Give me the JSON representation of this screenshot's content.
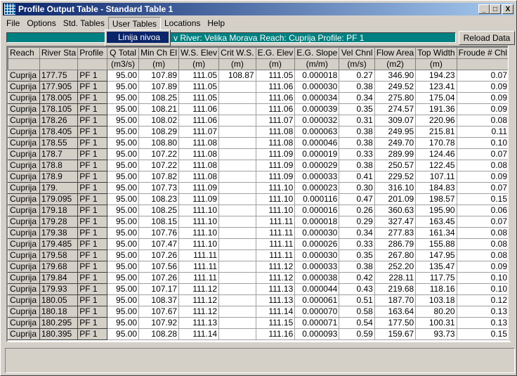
{
  "window": {
    "title": "Profile Output Table - Standard Table 1",
    "controls": [
      "_",
      "□",
      "X"
    ]
  },
  "menu": [
    "File",
    "Options",
    "Std. Tables",
    "User Tables",
    "Locations",
    "Help"
  ],
  "dropdown": {
    "items": [
      "Linija nivoa"
    ]
  },
  "banner": "v  River: Velika Morava   Reach: Cuprija    Profile: PF 1",
  "reload_label": "Reload Data",
  "colors": {
    "banner": "#008080",
    "title_start": "#0a246a",
    "selection": "#0a246a"
  },
  "table": {
    "headers": [
      "Reach",
      "River Sta",
      "Profile",
      "Q Total",
      "Min Ch El",
      "W.S. Elev",
      "Crit W.S.",
      "E.G. Elev",
      "E.G. Slope",
      "Vel Chnl",
      "Flow Area",
      "Top Width",
      "Froude # Chl"
    ],
    "units": [
      "",
      "",
      "",
      "(m3/s)",
      "(m)",
      "(m)",
      "(m)",
      "(m)",
      "(m/m)",
      "(m/s)",
      "(m2)",
      "(m)",
      ""
    ],
    "rows": [
      [
        "Cuprija",
        "177.75",
        "PF 1",
        "95.00",
        "107.89",
        "111.05",
        "108.87",
        "111.05",
        "0.000018",
        "0.27",
        "346.90",
        "194.23",
        "0.07"
      ],
      [
        "Cuprija",
        "177.905",
        "PF 1",
        "95.00",
        "107.89",
        "111.05",
        "",
        "111.06",
        "0.000030",
        "0.38",
        "249.52",
        "123.41",
        "0.09"
      ],
      [
        "Cuprija",
        "178.005",
        "PF 1",
        "95.00",
        "108.25",
        "111.05",
        "",
        "111.06",
        "0.000034",
        "0.34",
        "275.80",
        "175.04",
        "0.09"
      ],
      [
        "Cuprija",
        "178.105",
        "PF 1",
        "95.00",
        "108.21",
        "111.06",
        "",
        "111.06",
        "0.000039",
        "0.35",
        "274.57",
        "191.36",
        "0.09"
      ],
      [
        "Cuprija",
        "178.26",
        "PF 1",
        "95.00",
        "108.02",
        "111.06",
        "",
        "111.07",
        "0.000032",
        "0.31",
        "309.07",
        "220.96",
        "0.08"
      ],
      [
        "Cuprija",
        "178.405",
        "PF 1",
        "95.00",
        "108.29",
        "111.07",
        "",
        "111.08",
        "0.000063",
        "0.38",
        "249.95",
        "215.81",
        "0.11"
      ],
      [
        "Cuprija",
        "178.55",
        "PF 1",
        "95.00",
        "108.80",
        "111.08",
        "",
        "111.08",
        "0.000046",
        "0.38",
        "249.70",
        "170.78",
        "0.10"
      ],
      [
        "Cuprija",
        "178.7",
        "PF 1",
        "95.00",
        "107.22",
        "111.08",
        "",
        "111.09",
        "0.000019",
        "0.33",
        "289.99",
        "124.46",
        "0.07"
      ],
      [
        "Cuprija",
        "178.8",
        "PF 1",
        "95.00",
        "107.22",
        "111.08",
        "",
        "111.09",
        "0.000029",
        "0.38",
        "250.57",
        "122.45",
        "0.08"
      ],
      [
        "Cuprija",
        "178.9",
        "PF 1",
        "95.00",
        "107.82",
        "111.08",
        "",
        "111.09",
        "0.000033",
        "0.41",
        "229.52",
        "107.11",
        "0.09"
      ],
      [
        "Cuprija",
        "179.",
        "PF 1",
        "95.00",
        "107.73",
        "111.09",
        "",
        "111.10",
        "0.000023",
        "0.30",
        "316.10",
        "184.83",
        "0.07"
      ],
      [
        "Cuprija",
        "179.095",
        "PF 1",
        "95.00",
        "108.23",
        "111.09",
        "",
        "111.10",
        "0.000116",
        "0.47",
        "201.09",
        "198.57",
        "0.15"
      ],
      [
        "Cuprija",
        "179.18",
        "PF 1",
        "95.00",
        "108.25",
        "111.10",
        "",
        "111.10",
        "0.000016",
        "0.26",
        "360.63",
        "195.90",
        "0.06"
      ],
      [
        "Cuprija",
        "179.28",
        "PF 1",
        "95.00",
        "108.15",
        "111.10",
        "",
        "111.11",
        "0.000018",
        "0.29",
        "327.47",
        "163.45",
        "0.07"
      ],
      [
        "Cuprija",
        "179.38",
        "PF 1",
        "95.00",
        "107.76",
        "111.10",
        "",
        "111.11",
        "0.000030",
        "0.34",
        "277.83",
        "161.34",
        "0.08"
      ],
      [
        "Cuprija",
        "179.485",
        "PF 1",
        "95.00",
        "107.47",
        "111.10",
        "",
        "111.11",
        "0.000026",
        "0.33",
        "286.79",
        "155.88",
        "0.08"
      ],
      [
        "Cuprija",
        "179.58",
        "PF 1",
        "95.00",
        "107.26",
        "111.11",
        "",
        "111.11",
        "0.000030",
        "0.35",
        "267.80",
        "147.95",
        "0.08"
      ],
      [
        "Cuprija",
        "179.68",
        "PF 1",
        "95.00",
        "107.56",
        "111.11",
        "",
        "111.12",
        "0.000033",
        "0.38",
        "252.20",
        "135.47",
        "0.09"
      ],
      [
        "Cuprija",
        "179.84",
        "PF 1",
        "95.00",
        "107.26",
        "111.11",
        "",
        "111.12",
        "0.000038",
        "0.42",
        "228.11",
        "117.75",
        "0.10"
      ],
      [
        "Cuprija",
        "179.93",
        "PF 1",
        "95.00",
        "107.17",
        "111.12",
        "",
        "111.13",
        "0.000044",
        "0.43",
        "219.68",
        "118.16",
        "0.10"
      ],
      [
        "Cuprija",
        "180.05",
        "PF 1",
        "95.00",
        "108.37",
        "111.12",
        "",
        "111.13",
        "0.000061",
        "0.51",
        "187.70",
        "103.18",
        "0.12"
      ],
      [
        "Cuprija",
        "180.18",
        "PF 1",
        "95.00",
        "107.67",
        "111.12",
        "",
        "111.14",
        "0.000070",
        "0.58",
        "163.64",
        "80.20",
        "0.13"
      ],
      [
        "Cuprija",
        "180.295",
        "PF 1",
        "95.00",
        "107.92",
        "111.13",
        "",
        "111.15",
        "0.000071",
        "0.54",
        "177.50",
        "100.31",
        "0.13"
      ],
      [
        "Cuprija",
        "180.395",
        "PF 1",
        "95.00",
        "108.28",
        "111.14",
        "",
        "111.16",
        "0.000093",
        "0.59",
        "159.67",
        "93.73",
        "0.15"
      ]
    ]
  }
}
